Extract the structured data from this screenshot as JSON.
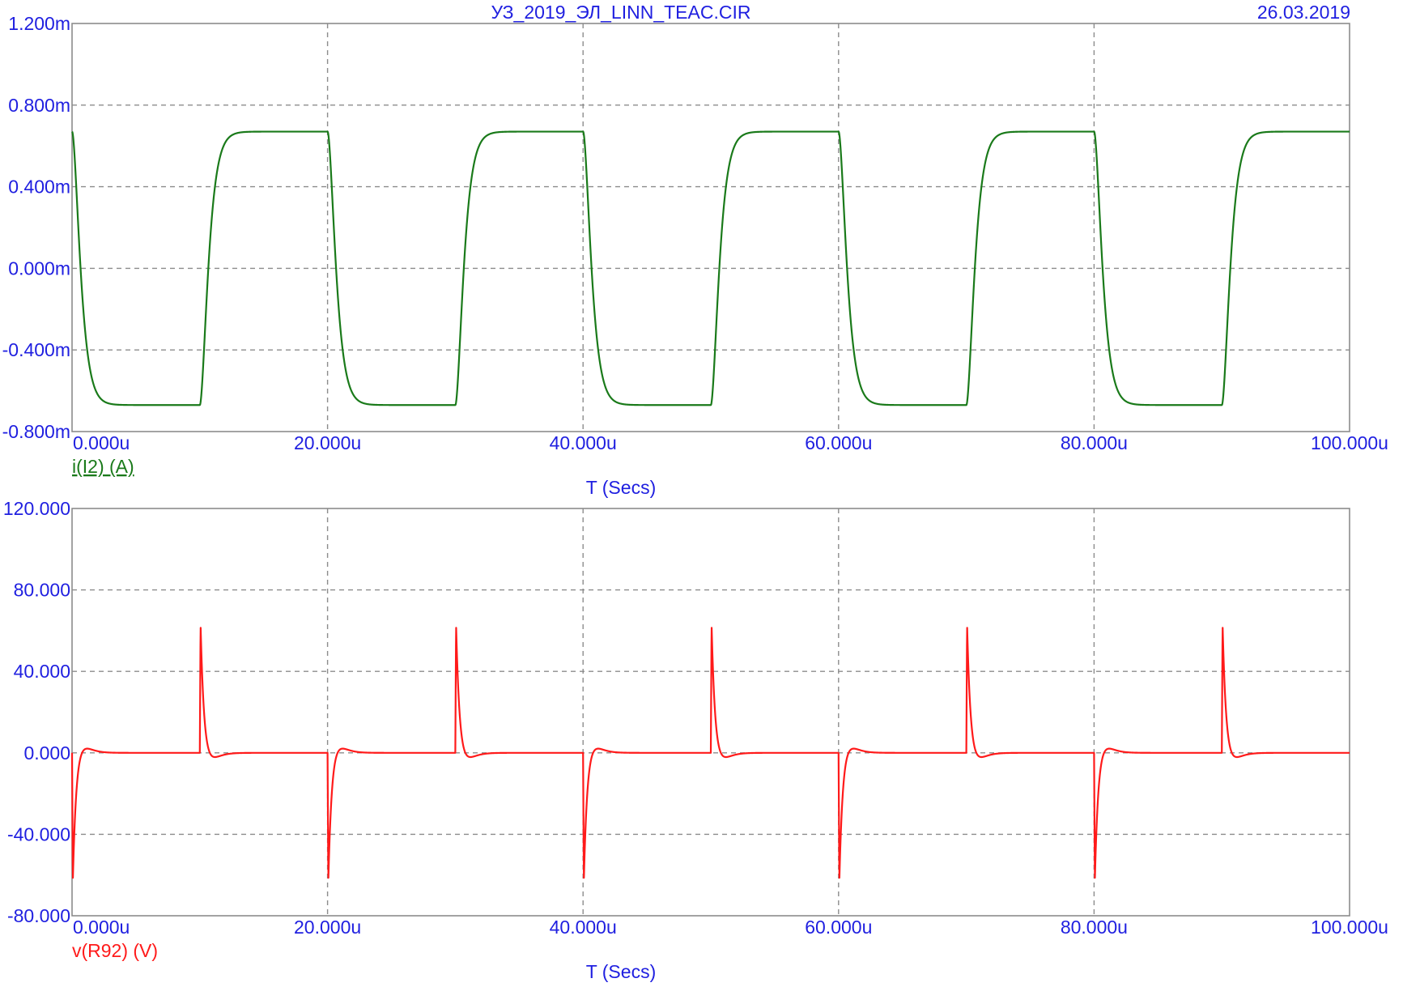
{
  "header": {
    "title": "УЗ_2019_ЭЛ_LINN_TEAC.CIR",
    "date": "26.03.2019"
  },
  "colors": {
    "text": "#1f1fe0",
    "grid": "#8c8c8c",
    "frame": "#8c8c8c",
    "series1": "#1a7a1a",
    "series2": "#ff1a1a"
  },
  "chart_data": [
    {
      "type": "line",
      "x_label": "T (Secs)",
      "x_ticks": [
        "0.000u",
        "20.000u",
        "40.000u",
        "60.000u",
        "80.000u",
        "100.000u"
      ],
      "x_range_us": [
        0,
        100
      ],
      "y_ticks": [
        "1.200m",
        "0.800m",
        "0.400m",
        "0.000m",
        "-0.400m",
        "-0.800m"
      ],
      "y_range": [
        -0.8,
        1.2
      ],
      "y_unit_scale": "milli",
      "grid": true,
      "series": [
        {
          "name": "i(I2) (A)",
          "shape": "square wave, period 20u, high 10u / low 10u, rounded edges",
          "high_value": 0.67,
          "low_value": -0.67,
          "overshoot": 0.69,
          "falling_edges_us": [
            0,
            20,
            40,
            60,
            80
          ],
          "rising_edges_us": [
            10,
            30,
            50,
            70,
            90
          ],
          "edge_time_constant_us": 0.4
        }
      ]
    },
    {
      "type": "line",
      "x_label": "T (Secs)",
      "x_ticks": [
        "0.000u",
        "20.000u",
        "40.000u",
        "60.000u",
        "80.000u",
        "100.000u"
      ],
      "x_range_us": [
        0,
        100
      ],
      "y_ticks": [
        "120.000",
        "80.000",
        "40.000",
        "0.000",
        "-40.000",
        "-80.000"
      ],
      "y_range": [
        -80,
        120
      ],
      "grid": true,
      "series": [
        {
          "name": "v(R92) (V)",
          "shape": "spikes at square-wave edges decaying to zero",
          "baseline": 0,
          "positive_peak": 63,
          "negative_peak": -63,
          "negative_spikes_us": [
            0,
            20,
            40,
            60,
            80
          ],
          "positive_spikes_us": [
            10,
            30,
            50,
            70,
            90
          ],
          "decay_time_constant_us": 0.4
        }
      ]
    }
  ]
}
